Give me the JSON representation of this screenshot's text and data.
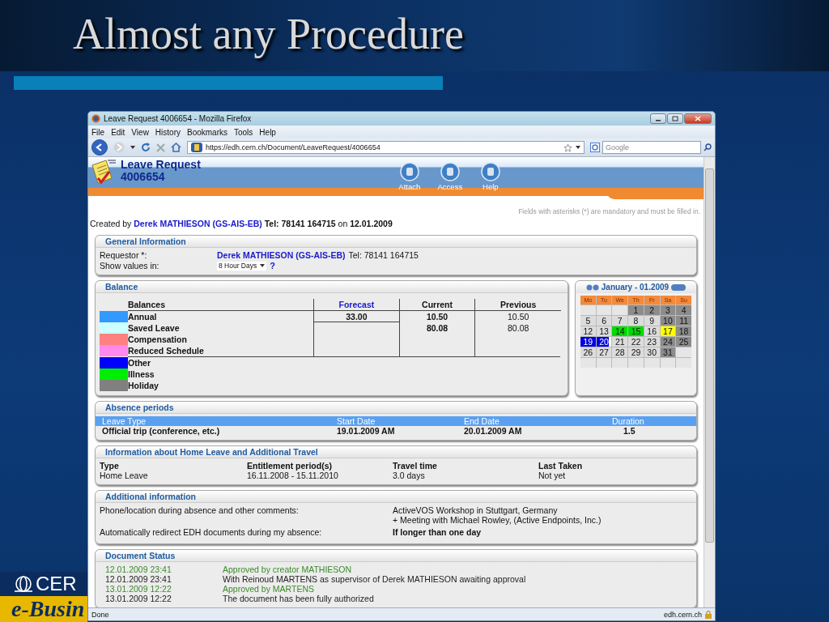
{
  "slide": {
    "title": "Almost any Procedure",
    "logo": {
      "line_1": "CER",
      "line_2": "e-Busin"
    }
  },
  "browser": {
    "title": "Leave Request 4006654 - Mozilla Firefox",
    "menu": [
      "File",
      "Edit",
      "View",
      "History",
      "Bookmarks",
      "Tools",
      "Help"
    ],
    "url": "https://edh.cern.ch/Document/LeaveRequest/4006654",
    "search": {
      "placeholder": "Google"
    },
    "status": "Done",
    "status_host": "edh.cern.ch"
  },
  "app": {
    "title": "Leave Request",
    "number": "4006654",
    "actions": [
      "Attach",
      "Access",
      "Help"
    ],
    "mandatory_note": "Fields with asterisks (*) are mandatory and must be filled in.",
    "created": {
      "prefix": "Created by",
      "person": "Derek MATHIESON (GS-AIS-EB)",
      "rest": "**Tel: 78141 164715** on **12.01.2009**"
    }
  },
  "general": {
    "title": "General Information",
    "requestor_label": "Requestor *:",
    "requestor": "Derek MATHIESON (GS-AIS-EB)",
    "requestor_tel": "Tel: 78141 164715",
    "show_label": "Show values in:",
    "show_value": "8 Hour Days",
    "help": "?"
  },
  "balance": {
    "title": "Balance",
    "columns": [
      {
        "label": "Balances",
        "highlighted": false
      },
      {
        "label": "Forecast",
        "highlighted": true
      },
      {
        "label": "Current",
        "highlighted": false
      },
      {
        "label": "Previous",
        "highlighted": false
      }
    ],
    "rows": [
      {
        "name": "Annual",
        "color": "#3399ff",
        "forecast": "33.00",
        "current": "10.50",
        "previous": "10.50"
      },
      {
        "name": "Saved Leave",
        "color": "#ccffff",
        "current": "80.08",
        "previous": "80.08"
      },
      {
        "name": "Compensation",
        "color": "#ff8080"
      },
      {
        "name": "Reduced Schedule",
        "color": "#ff88ee"
      }
    ],
    "other_types": [
      {
        "name": "Other",
        "color": "#0000ff"
      },
      {
        "name": "Illness",
        "color": "#00ee00"
      },
      {
        "name": "Holiday",
        "color": "#808080"
      }
    ]
  },
  "calendar": {
    "title": "January - 01.2009",
    "weekdays": [
      "Mo",
      "Tu",
      "We",
      "Th",
      "Fr",
      "Sa",
      "Su"
    ],
    "weeks": [
      [
        {
          "kind": "empty"
        },
        {
          "kind": "empty"
        },
        {
          "kind": "empty"
        },
        {
          "kind": "day",
          "day": "1",
          "color": "#8c8c8c"
        },
        {
          "kind": "day",
          "day": "2",
          "color": "#8c8c8c"
        },
        {
          "kind": "day",
          "day": "3",
          "color": "#8c8c8c"
        },
        {
          "kind": "day",
          "day": "4",
          "color": "#8c8c8c"
        }
      ],
      [
        {
          "kind": "day",
          "day": "5",
          "color": "#dcdcdc"
        },
        {
          "kind": "day",
          "day": "6",
          "color": "#dcdcdc"
        },
        {
          "kind": "day",
          "day": "7",
          "color": "#dcdcdc"
        },
        {
          "kind": "day",
          "day": "8",
          "color": "#dcdcdc"
        },
        {
          "kind": "day",
          "day": "9",
          "color": "#dcdcdc"
        },
        {
          "kind": "day",
          "day": "10",
          "color": "#8c8c8c"
        },
        {
          "kind": "day",
          "day": "11",
          "color": "#8c8c8c"
        }
      ],
      [
        {
          "kind": "day",
          "day": "12",
          "color": "#dcdcdc"
        },
        {
          "kind": "day",
          "day": "13",
          "color": "#dcdcdc"
        },
        {
          "kind": "day",
          "day": "14",
          "color": "#00dd00"
        },
        {
          "kind": "day",
          "day": "15",
          "color": "#00dd00"
        },
        {
          "kind": "day",
          "day": "16",
          "color": "#dcdcdc"
        },
        {
          "kind": "day",
          "day": "17",
          "color": "#ffff00"
        },
        {
          "kind": "day",
          "day": "18",
          "color": "#8c8c8c"
        }
      ],
      [
        {
          "kind": "day",
          "day": "19",
          "color": "#0000e0"
        },
        {
          "kind": "day",
          "day": "20",
          "color": "#0000e0",
          "half": true
        },
        {
          "kind": "day",
          "day": "21",
          "color": "#dcdcdc"
        },
        {
          "kind": "day",
          "day": "22",
          "color": "#dcdcdc"
        },
        {
          "kind": "day",
          "day": "23",
          "color": "#dcdcdc"
        },
        {
          "kind": "day",
          "day": "24",
          "color": "#8c8c8c"
        },
        {
          "kind": "day",
          "day": "25",
          "color": "#8c8c8c"
        }
      ],
      [
        {
          "kind": "day",
          "day": "26",
          "color": "#dcdcdc"
        },
        {
          "kind": "day",
          "day": "27",
          "color": "#dcdcdc"
        },
        {
          "kind": "day",
          "day": "28",
          "color": "#dcdcdc"
        },
        {
          "kind": "day",
          "day": "29",
          "color": "#dcdcdc"
        },
        {
          "kind": "day",
          "day": "30",
          "color": "#dcdcdc"
        },
        {
          "kind": "day",
          "day": "31",
          "color": "#8c8c8c"
        },
        {
          "kind": "empty"
        }
      ],
      [
        {
          "kind": "empty"
        },
        {
          "kind": "empty"
        },
        {
          "kind": "empty"
        },
        {
          "kind": "empty"
        },
        {
          "kind": "empty"
        },
        {
          "kind": "empty"
        },
        {
          "kind": "empty"
        }
      ]
    ]
  },
  "absence": {
    "title": "Absence periods",
    "columns": [
      "Leave Type",
      "Start Date",
      "End Date",
      "Duration"
    ],
    "rows": [
      [
        "Official trip (conference, etc.)",
        "19.01.2009 AM",
        "20.01.2009 AM",
        "1.5"
      ]
    ]
  },
  "home_leave": {
    "title": "Information about Home Leave and Additional Travel",
    "columns": [
      "Type",
      "Entitlement period(s)",
      "Travel time",
      "Last Taken"
    ],
    "rows": [
      [
        "Home Leave",
        "16.11.2008 - 15.11.2010",
        "3.0 days",
        "Not yet"
      ]
    ]
  },
  "additional": {
    "title": "Additional information",
    "rows": [
      {
        "label": "Phone/location during absence and other comments:",
        "lines": [
          "ActiveVOS Workshop in Stuttgart, Germany",
          "+ Meeting with Michael Rowley, (Active Endpoints, Inc.)"
        ],
        "strong": false
      },
      {
        "label": "Automatically redirect EDH documents during my absence:",
        "lines": [
          "If longer than one day"
        ],
        "strong": true
      }
    ]
  },
  "status": {
    "title": "Document Status",
    "entries": [
      {
        "time": "12.01.2009 23:41",
        "text": "Approved by creator MATHIESON",
        "color": "#3a8a2a"
      },
      {
        "time": "12.01.2009 23:41",
        "text": "With Reinoud MARTENS as supervisor of Derek MATHIESON awaiting approval",
        "color": "#222222"
      },
      {
        "time": "13.01.2009 12:22",
        "text": "Approved by MARTENS",
        "color": "#3a8a2a"
      },
      {
        "time": "13.01.2009 12:22",
        "text": "The document has been fully authorized",
        "color": "#222222"
      }
    ]
  }
}
